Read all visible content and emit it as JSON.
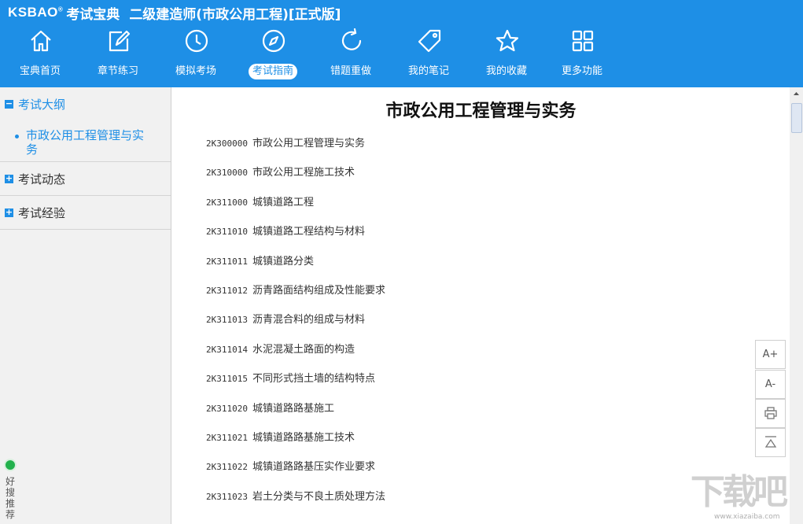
{
  "header": {
    "logo": "KSBAO",
    "brand": "考试宝典",
    "title": "二级建造师(市政公用工程)[正式版]",
    "bg_color": "#1e8fe6"
  },
  "nav": [
    {
      "label": "宝典首页",
      "icon": "home-icon"
    },
    {
      "label": "章节练习",
      "icon": "edit-icon"
    },
    {
      "label": "模拟考场",
      "icon": "clock-icon"
    },
    {
      "label": "考试指南",
      "icon": "compass-icon",
      "active": true
    },
    {
      "label": "错题重做",
      "icon": "refresh-icon"
    },
    {
      "label": "我的笔记",
      "icon": "tag-icon"
    },
    {
      "label": "我的收藏",
      "icon": "star-icon"
    },
    {
      "label": "更多功能",
      "icon": "grid-icon"
    }
  ],
  "sidebar": {
    "groups": [
      {
        "toggle": "−",
        "label": "考试大纲",
        "sub": "市政公用工程管理与实务"
      },
      {
        "toggle": "+",
        "label": "考试动态"
      },
      {
        "toggle": "+",
        "label": "考试经验"
      }
    ],
    "promo": "好搜推荐"
  },
  "content": {
    "title": "市政公用工程管理与实务",
    "items": [
      {
        "code": "2K300000",
        "text": "市政公用工程管理与实务"
      },
      {
        "code": "2K310000",
        "text": "市政公用工程施工技术"
      },
      {
        "code": "2K311000",
        "text": "城镇道路工程"
      },
      {
        "code": "2K311010",
        "text": "城镇道路工程结构与材料"
      },
      {
        "code": "2K311011",
        "text": "城镇道路分类"
      },
      {
        "code": "2K311012",
        "text": "沥青路面结构组成及性能要求"
      },
      {
        "code": "2K311013",
        "text": "沥青混合料的组成与材料"
      },
      {
        "code": "2K311014",
        "text": "水泥混凝土路面的构造"
      },
      {
        "code": "2K311015",
        "text": "不同形式挡土墙的结构特点"
      },
      {
        "code": "2K311020",
        "text": "城镇道路路基施工"
      },
      {
        "code": "2K311021",
        "text": "城镇道路路基施工技术"
      },
      {
        "code": "2K311022",
        "text": "城镇道路路基压实作业要求"
      },
      {
        "code": "2K311023",
        "text": "岩土分类与不良土质处理方法"
      }
    ]
  },
  "tools": {
    "font_up": "A+",
    "font_down": "A-"
  },
  "watermark": {
    "text": "下载吧",
    "url": "www.xiazaiba.com"
  }
}
